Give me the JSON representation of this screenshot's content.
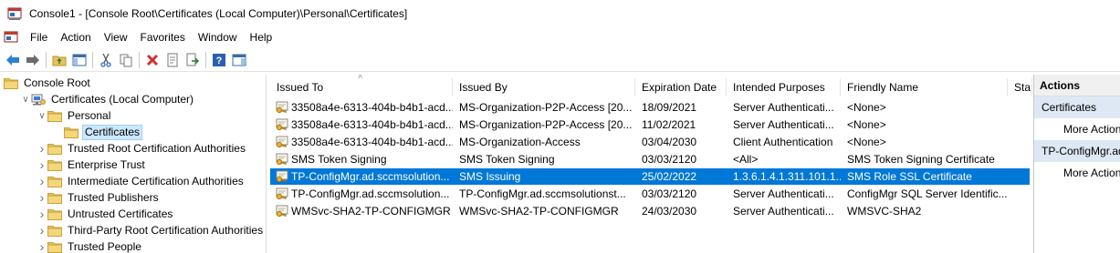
{
  "window": {
    "title": "Console1 - [Console Root\\Certificates (Local Computer)\\Personal\\Certificates]"
  },
  "menu": {
    "items": [
      "File",
      "Action",
      "View",
      "Favorites",
      "Window",
      "Help"
    ]
  },
  "toolbar": {
    "icons": [
      "back-arrow-icon",
      "forward-arrow-icon",
      "up-folder-icon",
      "show-hide-tree-icon",
      "cut-icon",
      "copy-icon",
      "delete-icon",
      "properties-icon",
      "export-icon",
      "help-icon",
      "show-action-pane-icon"
    ]
  },
  "tree": {
    "items": [
      {
        "label": "Console Root",
        "level": 0,
        "expander": "",
        "selected": false
      },
      {
        "label": "Certificates (Local Computer)",
        "level": 1,
        "expander": "open",
        "selected": false
      },
      {
        "label": "Personal",
        "level": 2,
        "expander": "open",
        "selected": false
      },
      {
        "label": "Certificates",
        "level": 3,
        "expander": "",
        "selected": true
      },
      {
        "label": "Trusted Root Certification Authorities",
        "level": 2,
        "expander": "closed",
        "selected": false
      },
      {
        "label": "Enterprise Trust",
        "level": 2,
        "expander": "closed",
        "selected": false
      },
      {
        "label": "Intermediate Certification Authorities",
        "level": 2,
        "expander": "closed",
        "selected": false
      },
      {
        "label": "Trusted Publishers",
        "level": 2,
        "expander": "closed",
        "selected": false
      },
      {
        "label": "Untrusted Certificates",
        "level": 2,
        "expander": "closed",
        "selected": false
      },
      {
        "label": "Third-Party Root Certification Authorities",
        "level": 2,
        "expander": "closed",
        "selected": false
      },
      {
        "label": "Trusted People",
        "level": 2,
        "expander": "closed",
        "selected": false
      }
    ]
  },
  "list": {
    "columns": [
      "Issued To",
      "Issued By",
      "Expiration Date",
      "Intended Purposes",
      "Friendly Name",
      "Sta"
    ],
    "rows": [
      {
        "issued_to": "33508a4e-6313-404b-b4b1-acd...",
        "issued_by": "MS-Organization-P2P-Access [20...",
        "expiration": "18/09/2021",
        "purposes": "Server Authenticati...",
        "friendly": "<None>",
        "status": "",
        "selected": false
      },
      {
        "issued_to": "33508a4e-6313-404b-b4b1-acd...",
        "issued_by": "MS-Organization-P2P-Access [20...",
        "expiration": "11/02/2021",
        "purposes": "Server Authenticati...",
        "friendly": "<None>",
        "status": "",
        "selected": false
      },
      {
        "issued_to": "33508a4e-6313-404b-b4b1-acd...",
        "issued_by": "MS-Organization-Access",
        "expiration": "03/04/2030",
        "purposes": "Client Authentication",
        "friendly": "<None>",
        "status": "",
        "selected": false
      },
      {
        "issued_to": "SMS Token Signing",
        "issued_by": "SMS Token Signing",
        "expiration": "03/03/2120",
        "purposes": "<All>",
        "friendly": "SMS Token Signing Certificate",
        "status": "",
        "selected": false
      },
      {
        "issued_to": "TP-ConfigMgr.ad.sccmsolution...",
        "issued_by": "SMS Issuing",
        "expiration": "25/02/2022",
        "purposes": "1.3.6.1.4.1.311.101.1...",
        "friendly": "SMS Role SSL Certificate",
        "status": "",
        "selected": true
      },
      {
        "issued_to": "TP-ConfigMgr.ad.sccmsolution...",
        "issued_by": "TP-ConfigMgr.ad.sccmsolutionst...",
        "expiration": "03/03/2120",
        "purposes": "Server Authenticati...",
        "friendly": "ConfigMgr SQL Server Identific...",
        "status": "",
        "selected": false
      },
      {
        "issued_to": "WMSvc-SHA2-TP-CONFIGMGR",
        "issued_by": "WMSvc-SHA2-TP-CONFIGMGR",
        "expiration": "24/03/2030",
        "purposes": "Server Authenticati...",
        "friendly": "WMSVC-SHA2",
        "status": "",
        "selected": false
      }
    ]
  },
  "actions": {
    "header": "Actions",
    "sections": [
      {
        "title": "Certificates",
        "item": "More Actions"
      },
      {
        "title": "TP-ConfigMgr.ad.sccmsolution...",
        "item": "More Actions"
      }
    ]
  },
  "colors": {
    "selection": "#0078d7",
    "tree_selection": "#cce8ff",
    "folder": "#e8c25a",
    "actions_section": "#dde8f4"
  }
}
